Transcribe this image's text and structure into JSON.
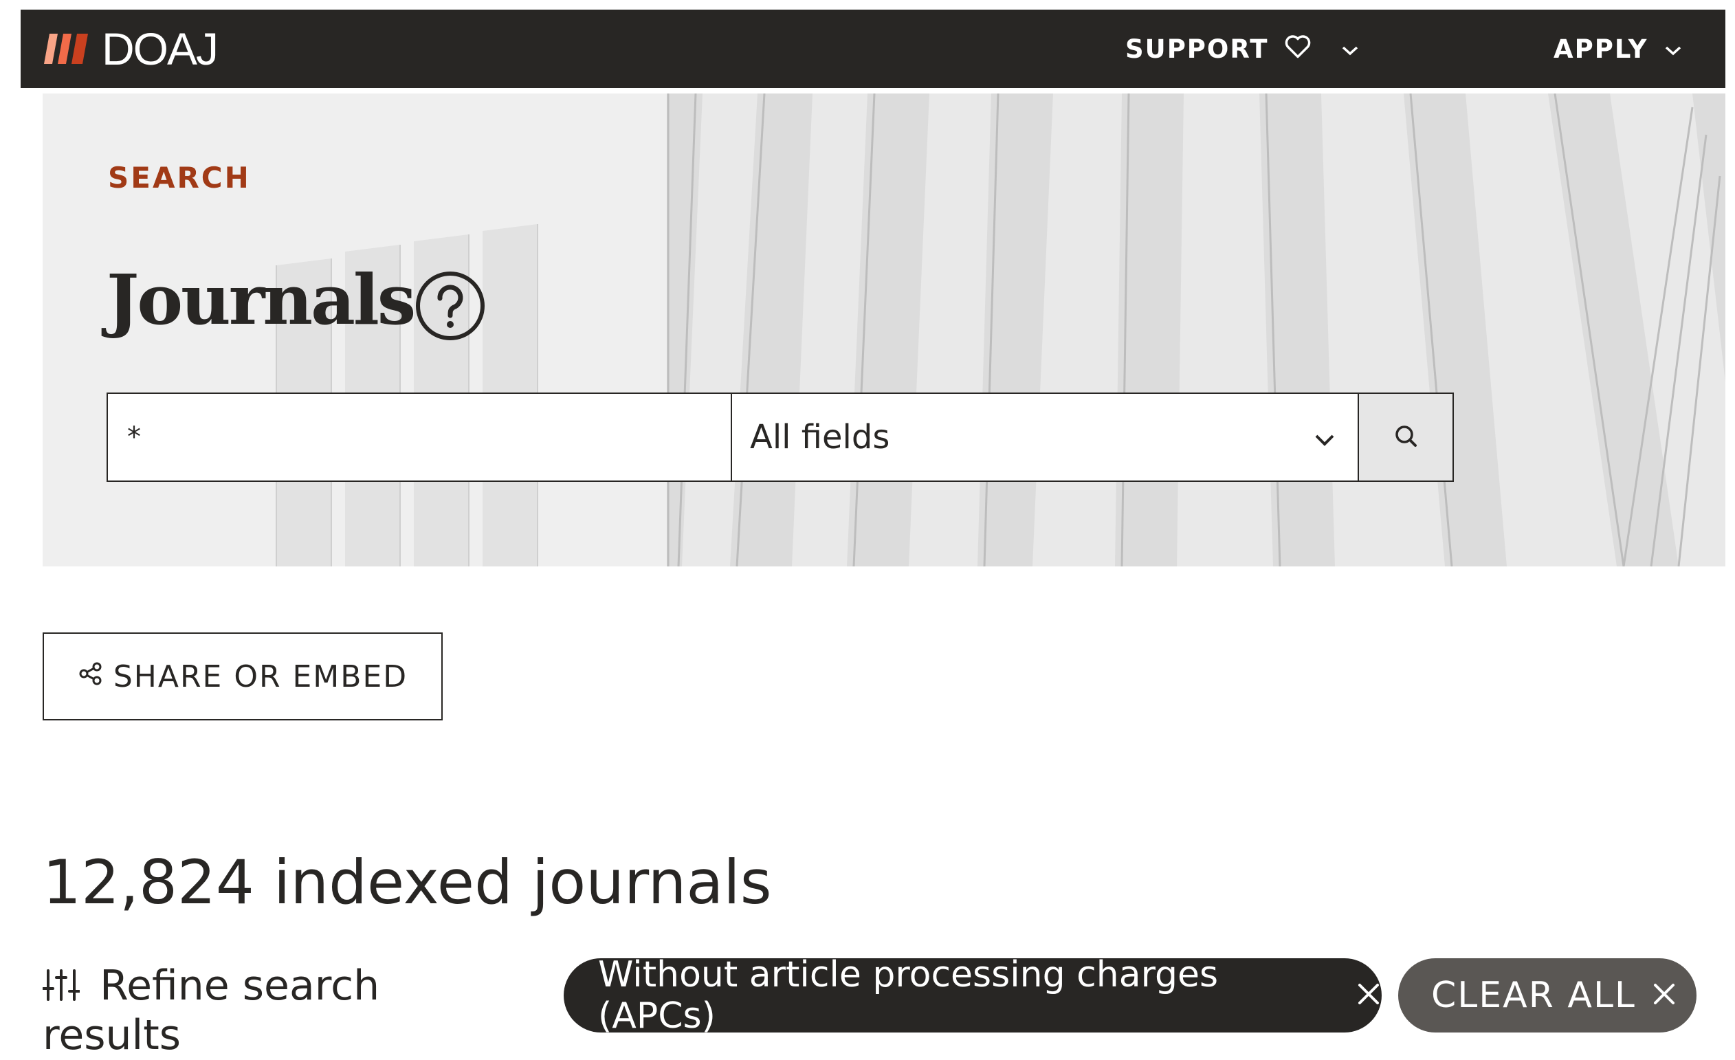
{
  "header": {
    "logo_text": "DOAJ",
    "nav": {
      "support_label": "SUPPORT",
      "apply_label": "APPLY"
    },
    "icons": {
      "logo": "doaj-logo-icon",
      "support": "heart-icon",
      "dropdown": "chevron-down-icon"
    }
  },
  "hero": {
    "eyebrow": "SEARCH",
    "title": "Journals",
    "help_icon": "help-circle-icon"
  },
  "search": {
    "query_value": "*",
    "field_selected": "All fields",
    "submit_icon": "search-icon"
  },
  "share": {
    "label": "SHARE OR EMBED",
    "icon": "share-icon"
  },
  "results": {
    "count_text": "12,824 indexed journals"
  },
  "filters": {
    "refine_label": "Refine search results",
    "refine_icon": "sliders-icon",
    "active": [
      {
        "label": "Without article processing charges (APCs)"
      }
    ],
    "clear_all_label": "CLEAR ALL"
  },
  "colors": {
    "topbar": "#282624",
    "eyebrow": "#a13a16",
    "logo_accent": "#f26b49",
    "chip_active": "#282624",
    "chip_clear": "#5a5754"
  }
}
